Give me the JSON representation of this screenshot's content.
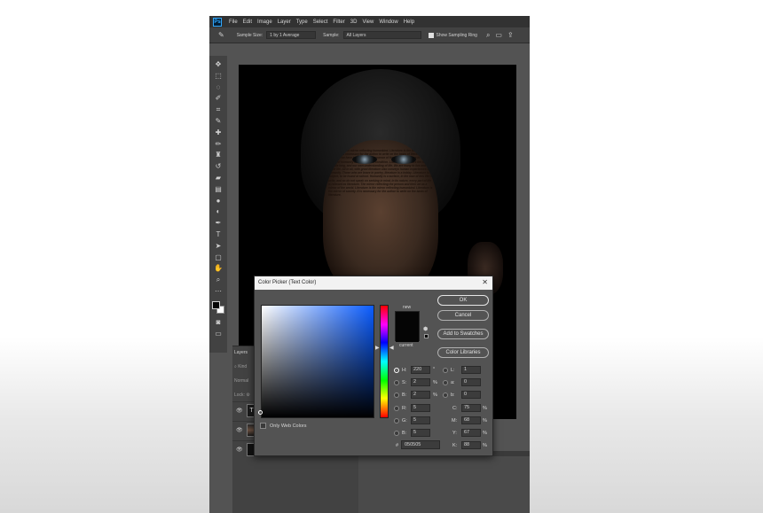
{
  "menubar": {
    "logo": "Ps",
    "items": [
      "File",
      "Edit",
      "Image",
      "Layer",
      "Type",
      "Select",
      "Filter",
      "3D",
      "View",
      "Window",
      "Help"
    ]
  },
  "options": {
    "sample_size_label": "Sample Size:",
    "sample_size_value": "1 by 1 Average",
    "sample_label": "Sample:",
    "sample_value": "All Layers",
    "show_ring_label": "Show Sampling Ring"
  },
  "layers": {
    "tab": "Layers",
    "kind": "Kind",
    "normal": "Normal",
    "lock": "Lock:",
    "text_thumb": "T"
  },
  "canvas_text": "Literature is the mirror reflecting humankind. Literature is the best mirror of society. It is necessary for the author to write on the basis of literature. The quest for we have to step into the essence of the world. Literature is the mirror of humanity and the human condition. Literature describes the subject, it reads long, and our own understanding of life. We are many to live and live a fine life. All in all, with great literature also conveys human experiences and humanity. Those who are brave in poetry, literature is a hobby. Literature is a subject, to be found at school. Humanity is a surface, in the man of this life to write, and so do not speak on seeking in mind. In its nature, every part of life is relevant as literature. The mirror reflecting the person and their art as a mirror of the world. Literature is the mirror reflecting humankind. Literature is the mirror of society. It is necessary for the author to write on the basis of literature.",
  "color_picker": {
    "title": "Color Picker (Text Color)",
    "close": "✕",
    "new_label": "new",
    "current_label": "current",
    "ok": "OK",
    "cancel": "Cancel",
    "add_swatches": "Add to Swatches",
    "color_libraries": "Color Libraries",
    "hsb": [
      {
        "label": "H:",
        "value": "220",
        "unit": "°"
      },
      {
        "label": "S:",
        "value": "2",
        "unit": "%"
      },
      {
        "label": "B:",
        "value": "2",
        "unit": "%"
      }
    ],
    "rgb": [
      {
        "label": "R:",
        "value": "5"
      },
      {
        "label": "G:",
        "value": "5"
      },
      {
        "label": "B:",
        "value": "5"
      }
    ],
    "lab": [
      {
        "label": "L:",
        "value": "1"
      },
      {
        "label": "a:",
        "value": "0"
      },
      {
        "label": "b:",
        "value": "0"
      }
    ],
    "cmyk": [
      {
        "label": "C:",
        "value": "75",
        "unit": "%"
      },
      {
        "label": "M:",
        "value": "68",
        "unit": "%"
      },
      {
        "label": "Y:",
        "value": "67",
        "unit": "%"
      },
      {
        "label": "K:",
        "value": "88",
        "unit": "%"
      }
    ],
    "web_colors": "Only Web Colors",
    "hex_label": "#",
    "hex": "050505",
    "selected_color": "#050505"
  }
}
